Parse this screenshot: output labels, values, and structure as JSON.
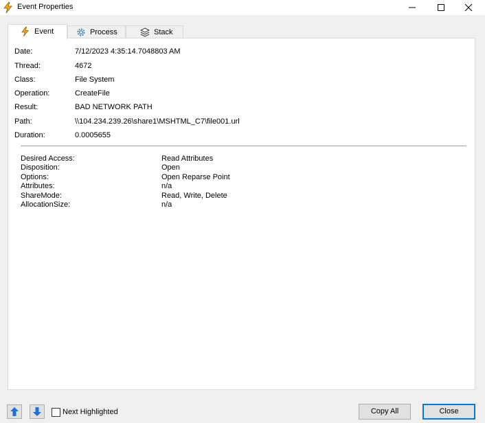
{
  "window": {
    "title": "Event Properties"
  },
  "tabs": [
    {
      "label": "Event",
      "icon": "lightning-icon"
    },
    {
      "label": "Process",
      "icon": "gear-icon"
    },
    {
      "label": "Stack",
      "icon": "stack-icon"
    }
  ],
  "properties": [
    {
      "label": "Date:",
      "value": "7/12/2023 4:35:14.7048803 AM"
    },
    {
      "label": "Thread:",
      "value": "4672"
    },
    {
      "label": "Class:",
      "value": "File System"
    },
    {
      "label": "Operation:",
      "value": "CreateFile"
    },
    {
      "label": "Result:",
      "value": "BAD NETWORK PATH"
    },
    {
      "label": "Path:",
      "value": "\\\\104.234.239.26\\share1\\MSHTML_C7\\file001.url"
    },
    {
      "label": "Duration:",
      "value": "0.0005655"
    }
  ],
  "details": [
    {
      "label": "Desired Access:",
      "value": "Read Attributes"
    },
    {
      "label": "Disposition:",
      "value": "Open"
    },
    {
      "label": "Options:",
      "value": "Open Reparse Point"
    },
    {
      "label": "Attributes:",
      "value": "n/a"
    },
    {
      "label": "ShareMode:",
      "value": "Read, Write, Delete"
    },
    {
      "label": "AllocationSize:",
      "value": "n/a"
    }
  ],
  "footer": {
    "next_highlighted_label": "Next Highlighted",
    "next_highlighted_checked": false,
    "copy_all_label": "Copy All",
    "close_label": "Close"
  },
  "colors": {
    "accent": "#0078d7",
    "icon_blue": "#1e6fd9",
    "lightning": "#f5a623"
  }
}
